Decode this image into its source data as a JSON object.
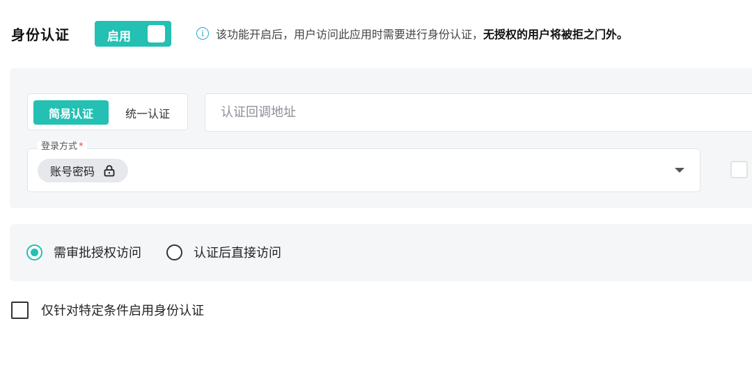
{
  "header": {
    "title": "身份认证",
    "toggle_label": "启用",
    "toggle_on": true,
    "info_icon": "info-circle-icon",
    "info_text": "该功能开启后，用户访问此应用时需要进行身份认证，",
    "info_text_bold": "无授权的用户将被拒之门外。"
  },
  "auth_mode": {
    "tabs": [
      {
        "label": "简易认证",
        "active": true
      },
      {
        "label": "统一认证",
        "active": false
      }
    ]
  },
  "callback": {
    "placeholder": "认证回调地址",
    "value": ""
  },
  "login_method": {
    "legend": "登录方式",
    "required_mark": "*",
    "selected_chip": "账号密码",
    "chip_icon": "lock-icon",
    "dropdown_icon": "caret-down-icon"
  },
  "access": {
    "options": [
      {
        "label": "需审批授权访问",
        "checked": true
      },
      {
        "label": "认证后直接访问",
        "checked": false
      }
    ]
  },
  "condition": {
    "label": "仅针对特定条件启用身份认证",
    "checked": false
  },
  "colors": {
    "accent": "#23c0b3",
    "info": "#23a8d6",
    "panel_bg": "#f5f6f7",
    "required": "#e5483d"
  }
}
